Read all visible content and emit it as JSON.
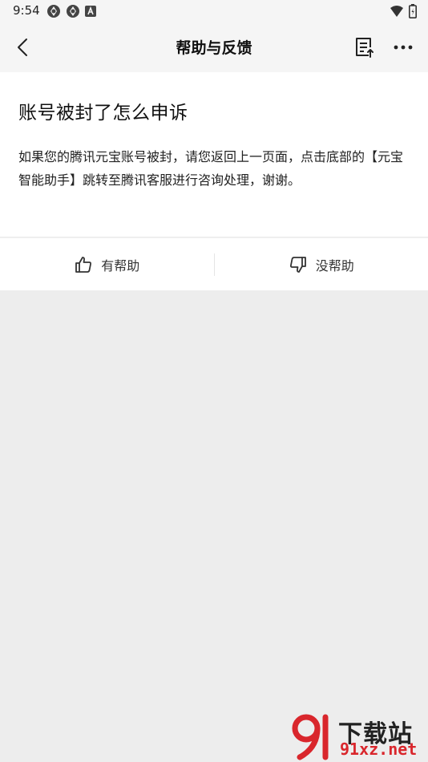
{
  "status_bar": {
    "time": "9:54",
    "left_icons": [
      "app-icon",
      "app-icon",
      "a-icon"
    ],
    "right_icons": [
      "wifi-icon",
      "battery-icon"
    ]
  },
  "nav": {
    "title": "帮助与反馈",
    "back_icon": "back-arrow-icon",
    "doc_icon": "document-icon",
    "more_icon": "more-icon"
  },
  "article": {
    "title": "账号被封了怎么申诉",
    "body": "如果您的腾讯元宝账号被封，请您返回上一页面，点击底部的【元宝智能助手】跳转至腾讯客服进行咨询处理，谢谢。"
  },
  "feedback": {
    "helpful_label": "有帮助",
    "unhelpful_label": "没帮助"
  },
  "watermark": {
    "top_text": "下载站",
    "bottom_text": "91xz.net"
  },
  "colors": {
    "background": "#ededed",
    "card": "#ffffff",
    "watermark_red": "#d9262c"
  }
}
